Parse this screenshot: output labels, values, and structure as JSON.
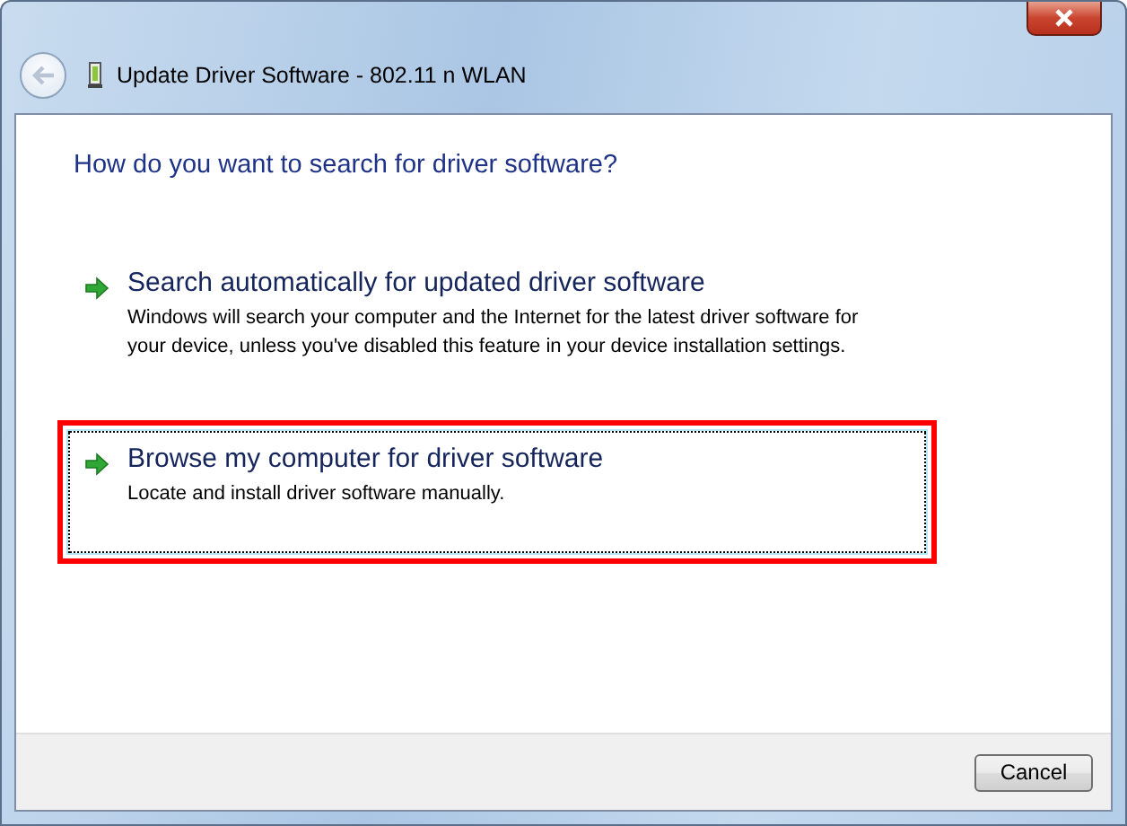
{
  "window": {
    "title": "Update Driver Software - 802.11 n WLAN"
  },
  "heading": "How do you want to search for driver software?",
  "options": [
    {
      "title": "Search automatically for updated driver software",
      "description": "Windows will search your computer and the Internet for the latest driver software for your device, unless you've disabled this feature in your device installation settings.",
      "selected": false,
      "highlighted": false
    },
    {
      "title": "Browse my computer for driver software",
      "description": "Locate and install driver software manually.",
      "selected": true,
      "highlighted": true
    }
  ],
  "buttons": [
    "Cancel"
  ]
}
